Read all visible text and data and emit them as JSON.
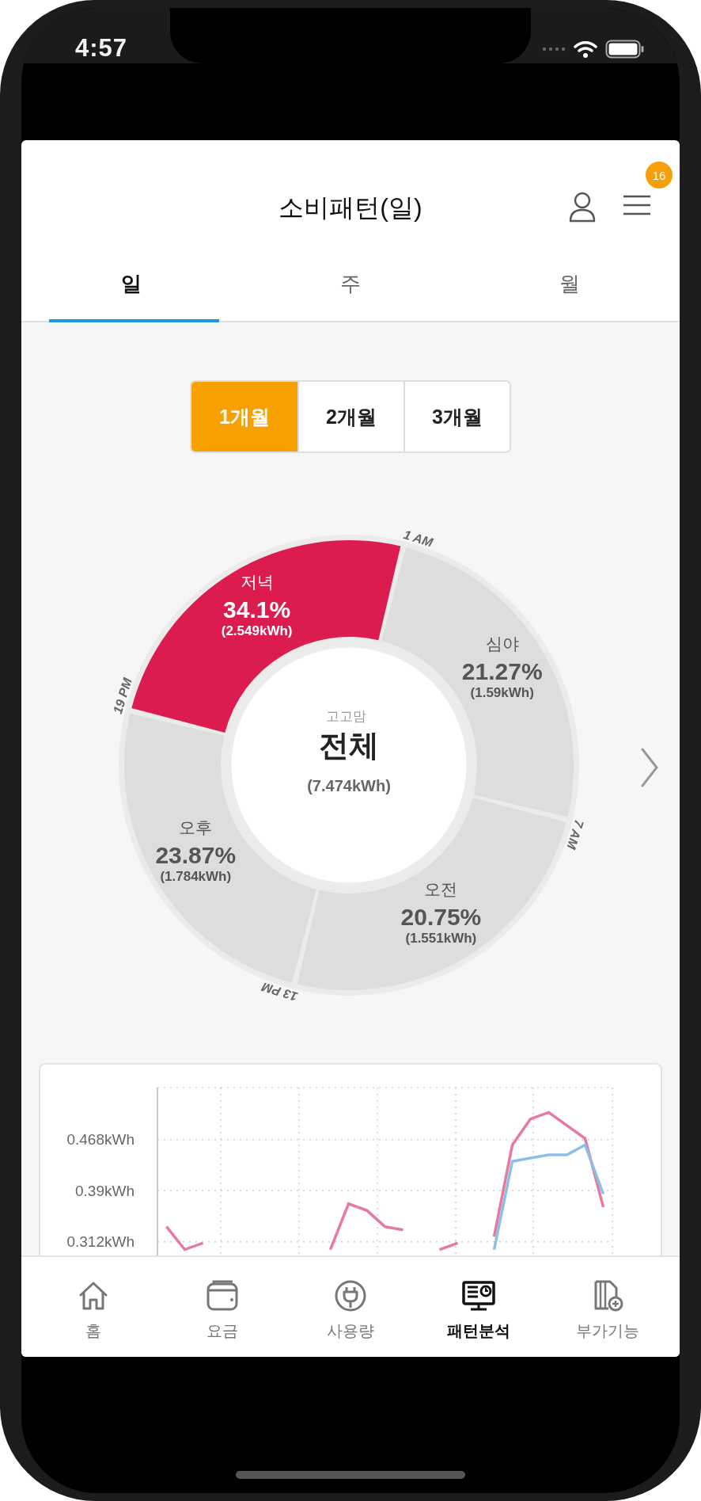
{
  "status_bar": {
    "time": "4:57"
  },
  "header": {
    "title": "소비패턴(일)",
    "badge": "16"
  },
  "tabs": [
    {
      "label": "일",
      "selected": true
    },
    {
      "label": "주",
      "selected": false
    },
    {
      "label": "월",
      "selected": false
    }
  ],
  "periods": [
    {
      "label": "1개월",
      "selected": true
    },
    {
      "label": "2개월",
      "selected": false
    },
    {
      "label": "3개월",
      "selected": false
    }
  ],
  "dial": {
    "caption": "고고맘",
    "title": "전체",
    "total": "(7.474kWh)",
    "segments": [
      {
        "name": "심야",
        "percent": "21.27%",
        "kwh": "(1.59kWh)",
        "start": "1 AM",
        "selected": false
      },
      {
        "name": "오전",
        "percent": "20.75%",
        "kwh": "(1.551kWh)",
        "start": "7 AM",
        "selected": false
      },
      {
        "name": "오후",
        "percent": "23.87%",
        "kwh": "(1.784kWh)",
        "start": "13 PM",
        "selected": false
      },
      {
        "name": "저녁",
        "percent": "34.1%",
        "kwh": "(2.549kWh)",
        "start": "19 PM",
        "selected": true
      }
    ]
  },
  "chart": {
    "chart_data": {
      "type": "line",
      "grid": true,
      "categories": [
        null,
        null,
        null,
        null,
        null,
        null,
        null,
        null,
        null,
        null,
        null,
        null,
        null,
        null,
        null,
        null,
        null,
        null,
        null,
        null,
        null,
        null,
        null,
        null,
        null
      ],
      "ylim": [
        0.2,
        0.548
      ],
      "yticks": [
        {
          "value": 0.312,
          "label": "0.312kWh"
        },
        {
          "value": 0.39,
          "label": "0.39kWh"
        },
        {
          "value": 0.468,
          "label": "0.468kWh"
        }
      ],
      "series": [
        {
          "color": "#e8799e",
          "values": [
            0.335,
            0.3,
            0.31,
            null,
            null,
            null,
            null,
            null,
            null,
            0.3,
            0.37,
            0.36,
            0.335,
            0.33,
            null,
            0.3,
            0.31,
            null,
            0.32,
            0.46,
            0.5,
            0.51,
            0.49,
            0.47,
            0.365
          ]
        },
        {
          "color": "#8cbfe8",
          "values": [
            null,
            null,
            null,
            null,
            null,
            null,
            null,
            null,
            null,
            null,
            null,
            null,
            null,
            null,
            null,
            null,
            null,
            null,
            0.3,
            0.435,
            0.44,
            0.445,
            0.445,
            0.46,
            0.385
          ]
        }
      ]
    }
  },
  "nav": [
    {
      "label": "홈",
      "kind": "home",
      "selected": false
    },
    {
      "label": "요금",
      "kind": "wallet",
      "selected": false
    },
    {
      "label": "사용량",
      "kind": "plug",
      "selected": false
    },
    {
      "label": "패턴분석",
      "kind": "monitor",
      "selected": true
    },
    {
      "label": "부가기능",
      "kind": "addon",
      "selected": false
    }
  ]
}
